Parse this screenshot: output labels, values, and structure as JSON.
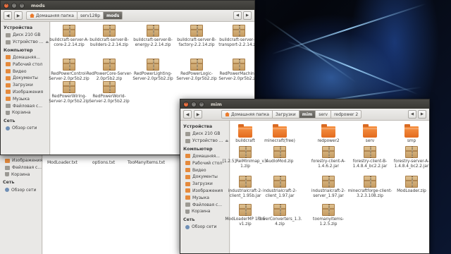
{
  "desktop": {
    "wallpaper": "blue-energy-face",
    "accent_colors": [
      "#0a1224",
      "#4d96ff",
      "#e36a1d"
    ]
  },
  "bg_window": {
    "sidebar_items": [
      {
        "label": "Изображения",
        "icon": "folder-icon"
      },
      {
        "label": "Файловая с...",
        "icon": "drive-icon",
        "eject": "⏏"
      },
      {
        "label": "Корзина",
        "icon": "trash-icon"
      }
    ],
    "network_section": "Сеть",
    "network_items": [
      {
        "label": "Обзор сети",
        "icon": "network-icon"
      }
    ],
    "files": [
      "ModLoader.txt",
      "options.txt",
      "TooManyItems.txt"
    ]
  },
  "window1": {
    "title": "mods",
    "back_label": "◀",
    "forward_label": "▶",
    "crumbs": [
      {
        "label": "Домашняя папка",
        "icon": "home-icon"
      },
      {
        "label": "serv128p"
      },
      {
        "label": "mods",
        "active": true
      }
    ],
    "right_buttons": [
      "◀",
      "▶"
    ],
    "sidebar": {
      "sections": [
        {
          "title": "Устройства",
          "items": [
            {
              "label": "Диск 210 GB",
              "icon": "drive-icon"
            },
            {
              "label": "Устройство ...",
              "icon": "drive-icon",
              "eject": "⏏"
            }
          ]
        },
        {
          "title": "Компьютер",
          "items": [
            {
              "label": "Домашняя...",
              "icon": "home-icon"
            },
            {
              "label": "Рабочий стол",
              "icon": "folder-icon"
            },
            {
              "label": "Видео",
              "icon": "folder-icon"
            },
            {
              "label": "Документы",
              "icon": "folder-icon"
            },
            {
              "label": "Загрузки",
              "icon": "folder-icon"
            },
            {
              "label": "Изображения",
              "icon": "folder-icon"
            },
            {
              "label": "Музыка",
              "icon": "folder-icon"
            },
            {
              "label": "Файловая с...",
              "icon": "drive-icon"
            },
            {
              "label": "Корзина",
              "icon": "trash-icon"
            }
          ]
        },
        {
          "title": "Сеть",
          "items": [
            {
              "label": "Обзор сети",
              "icon": "network-icon"
            }
          ]
        }
      ]
    },
    "files": [
      "buildcraft-server-A-core-2.2.14.zip",
      "buildcraft-server-B-builders-2.2.14.zip",
      "buildcraft-server-B-energy-2.2.14.zip",
      "buildcraft-server-B-factory-2.2.14.zip",
      "buildcraft-server-B-transport-2.2.14.zip",
      "RedPowerControl-Server-2.0pr5b2.zip",
      "RedPowerCore-Server-2.0pr5b2.zip",
      "RedPowerLighting-Server-2.0pr5b2.zip",
      "RedPowerLogic-Server-2.0pr5b2.zip",
      "RedPowerMachine-Server-2.0pr5b2.zip",
      "RedPowerWiring-Server-2.0pr5b2.zip",
      "RedPowerWorld-Server-2.0pr5b2.zip"
    ]
  },
  "window2": {
    "title": "mim",
    "back_label": "◀",
    "forward_label": "▶",
    "crumbs": [
      {
        "label": "Домашняя папка",
        "icon": "home-icon"
      },
      {
        "label": "Загрузки"
      },
      {
        "label": "mim",
        "active": true
      },
      {
        "label": "serv"
      },
      {
        "label": "redpower 2"
      }
    ],
    "right_buttons": [
      "◀",
      "▶"
    ],
    "sidebar": {
      "sections": [
        {
          "title": "Устройства",
          "items": [
            {
              "label": "Диск 210 GB",
              "icon": "drive-icon"
            },
            {
              "label": "Устройство ...",
              "icon": "drive-icon",
              "eject": "⏏"
            }
          ]
        },
        {
          "title": "Компьютер",
          "items": [
            {
              "label": "Домашняя...",
              "icon": "home-icon"
            },
            {
              "label": "Рабочий стол",
              "icon": "folder-icon"
            },
            {
              "label": "Видео",
              "icon": "folder-icon"
            },
            {
              "label": "Документы",
              "icon": "folder-icon"
            },
            {
              "label": "Загрузки",
              "icon": "folder-icon"
            },
            {
              "label": "Изображения",
              "icon": "folder-icon"
            },
            {
              "label": "Музыка",
              "icon": "folder-icon"
            },
            {
              "label": "Файловая с...",
              "icon": "drive-icon"
            },
            {
              "label": "Корзина",
              "icon": "trash-icon"
            }
          ]
        },
        {
          "title": "Сеть",
          "items": [
            {
              "label": "Обзор сети",
              "icon": "network-icon"
            }
          ]
        }
      ]
    },
    "files": [
      {
        "name": "buildcraft",
        "type": "folder"
      },
      {
        "name": "minecraft(free)",
        "type": "folder"
      },
      {
        "name": "redpower2",
        "type": "folder"
      },
      {
        "name": "serv",
        "type": "folder"
      },
      {
        "name": "smp",
        "type": "folder"
      },
      {
        "name": "[1.2.5]ReiMinimap_v3.1.zip",
        "type": "zip"
      },
      {
        "name": "AudioMod.zip",
        "type": "zip"
      },
      {
        "name": "forestry-client-A-1.4.6.2.jar",
        "type": "zip"
      },
      {
        "name": "forestry-client-B-1.4.8.4_bc2.2.jar",
        "type": "zip"
      },
      {
        "name": "forestry-server-A-1.4.8.4_bc2.2.jar",
        "type": "zip"
      },
      {
        "name": "industrialcraft-2-client_1.95b.jar",
        "type": "zip"
      },
      {
        "name": "industrialcraft-2-client_1.97.jar",
        "type": "zip"
      },
      {
        "name": "industrialcraft-2-server_1.97.jar",
        "type": "zip"
      },
      {
        "name": "minecraftforge-client-3.2.3.108.zip",
        "type": "zip"
      },
      {
        "name": "ModLoader.zip",
        "type": "zip"
      },
      {
        "name": "ModLoaderMP 1.2.5 v1.zip",
        "type": "zip"
      },
      {
        "name": "PowerConverters_1.3.4.zip",
        "type": "zip"
      },
      {
        "name": "toomanyitems-1.2.5.zip",
        "type": "zip"
      }
    ]
  }
}
